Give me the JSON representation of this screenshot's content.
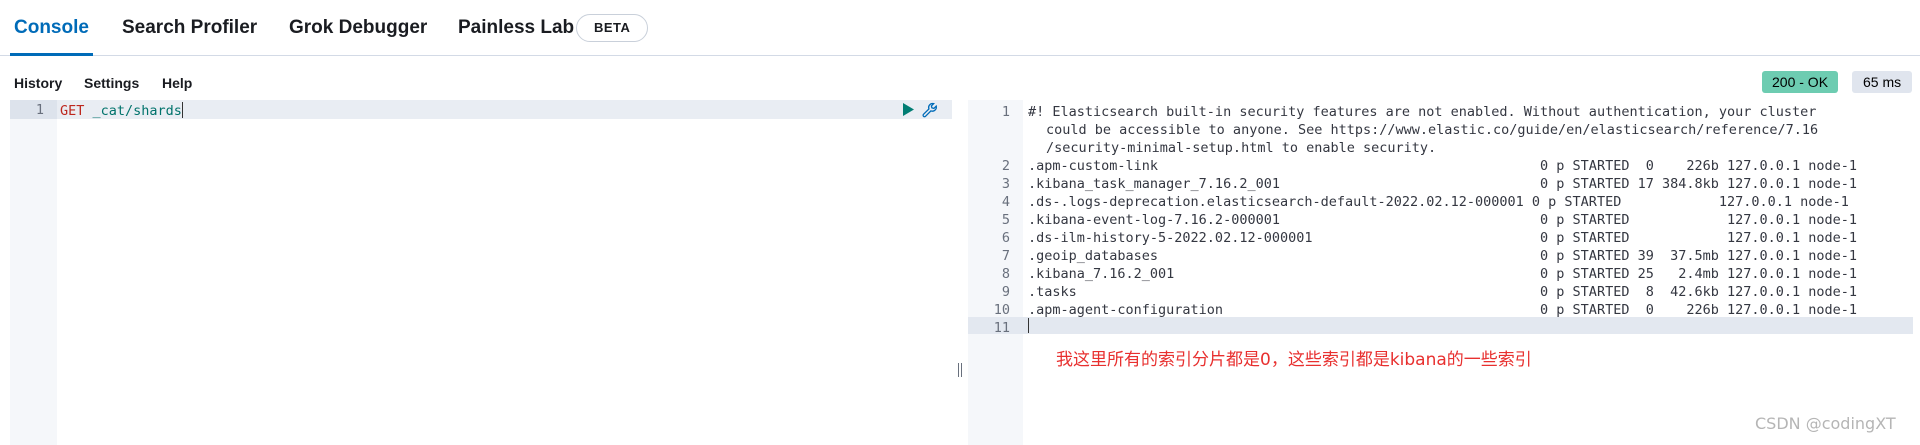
{
  "tabs": [
    {
      "label": "Console",
      "active": true
    },
    {
      "label": "Search Profiler",
      "active": false
    },
    {
      "label": "Grok Debugger",
      "active": false
    },
    {
      "label": "Painless Lab",
      "active": false
    }
  ],
  "beta_badge": "BETA",
  "toolbar": {
    "menu": [
      "History",
      "Settings",
      "Help"
    ],
    "status": "200 - OK",
    "time": "65 ms"
  },
  "editor": {
    "lines": [
      {
        "number": "1",
        "method": "GET",
        "path": "_cat/shards"
      }
    ],
    "icons": {
      "run": "play-icon",
      "settings": "wrench-icon"
    }
  },
  "output": {
    "lines": [
      {
        "number": "1",
        "text": "#! Elasticsearch built-in security features are not enabled. Without authentication, your cluster"
      },
      {
        "number": "",
        "text": "could be accessible to anyone. See https://www.elastic.co/guide/en/elasticsearch/reference/7.16"
      },
      {
        "number": "",
        "text": "/security-minimal-setup.html to enable security."
      },
      {
        "number": "2",
        "text": ".apm-custom-link                                               0 p STARTED  0    226b 127.0.0.1 node-1"
      },
      {
        "number": "3",
        "text": ".kibana_task_manager_7.16.2_001                                0 p STARTED 17 384.8kb 127.0.0.1 node-1"
      },
      {
        "number": "4",
        "text": ".ds-.logs-deprecation.elasticsearch-default-2022.02.12-000001 0 p STARTED            127.0.0.1 node-1"
      },
      {
        "number": "5",
        "text": ".kibana-event-log-7.16.2-000001                                0 p STARTED            127.0.0.1 node-1"
      },
      {
        "number": "6",
        "text": ".ds-ilm-history-5-2022.02.12-000001                            0 p STARTED            127.0.0.1 node-1"
      },
      {
        "number": "7",
        "text": ".geoip_databases                                               0 p STARTED 39  37.5mb 127.0.0.1 node-1"
      },
      {
        "number": "8",
        "text": ".kibana_7.16.2_001                                             0 p STARTED 25   2.4mb 127.0.0.1 node-1"
      },
      {
        "number": "9",
        "text": ".tasks                                                         0 p STARTED  8  42.6kb 127.0.0.1 node-1"
      },
      {
        "number": "10",
        "text": ".apm-agent-configuration                                       0 p STARTED  0    226b 127.0.0.1 node-1"
      },
      {
        "number": "11",
        "text": ""
      }
    ]
  },
  "annotation": "我这里所有的索引分片都是0，这些索引都是kibana的一些索引",
  "watermark": "CSDN @codingXT",
  "colors": {
    "accent": "#006bb8",
    "status_ok": "#6dccb1",
    "method": "#bd271e",
    "path": "#00726b",
    "annotation": "#e8302f"
  }
}
